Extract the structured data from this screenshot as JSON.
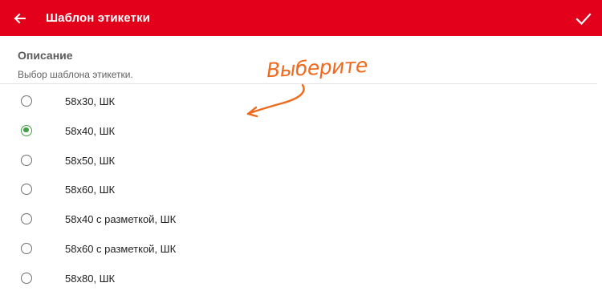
{
  "header": {
    "title": "Шаблон этикетки",
    "back_icon": "arrow-left-icon",
    "done_icon": "check-icon",
    "bar_color": "#e3001b"
  },
  "section": {
    "title": "Описание",
    "subtitle": "Выбор шаблона этикетки."
  },
  "options": [
    {
      "label": "58x30, ШК",
      "selected": false
    },
    {
      "label": "58x40, ШК",
      "selected": true
    },
    {
      "label": "58x50, ШК",
      "selected": false
    },
    {
      "label": "58x60, ШК",
      "selected": false
    },
    {
      "label": "58x40 с разметкой, ШК",
      "selected": false
    },
    {
      "label": "58x60 с разметкой, ШК",
      "selected": false
    },
    {
      "label": "58x80, ШК",
      "selected": false
    }
  ],
  "annotation": {
    "text": "Выберите",
    "color": "#f06a1e"
  },
  "colors": {
    "radio_selected": "#43a047"
  }
}
